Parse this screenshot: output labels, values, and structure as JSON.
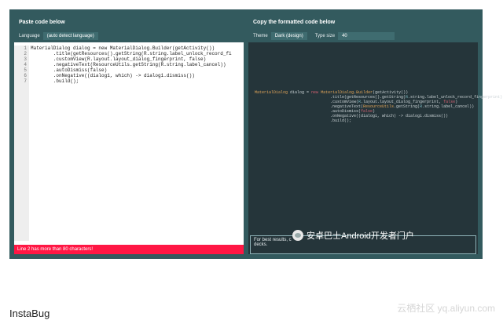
{
  "left_panel": {
    "title": "Paste code below",
    "lang_label": "Language",
    "lang_value": "(auto detect language)",
    "line_numbers": [
      "1",
      "2",
      "3",
      "4",
      "5",
      "6",
      "7"
    ],
    "code_lines": [
      "MaterialDialog dialog = new MaterialDialog.Builder(getActivity())",
      "        .title(getResources().getString(R.string.label_unlock_record_fi",
      "        .customView(R.layout.layout_dialog_fingerprint, false)",
      "        .negativeText(ResourceUtils.getString(R.string.label_cancel))",
      "        .autoDismiss(false)",
      "        .onNegative((dialog1, which) -> dialog1.dismiss())",
      "        .build();"
    ],
    "error": "Line 2 has more than 80 characters!"
  },
  "right_panel": {
    "title": "Copy the formatted code below",
    "theme_label": "Theme",
    "theme_value": "Dark (design)",
    "type_label": "Type size",
    "type_value": "40",
    "hint_line1": "For best results, c",
    "hint_line2": "decks."
  },
  "watermark_1": "安卓巴士Android开发者门户",
  "watermark_2": "云栖社区 yq.aliyun.com",
  "caption": "InstaBug"
}
